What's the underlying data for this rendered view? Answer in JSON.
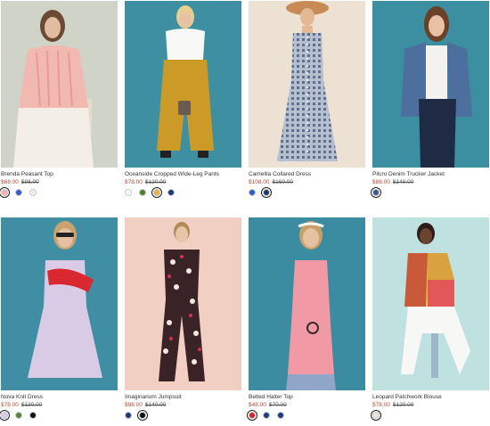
{
  "products": [
    {
      "name": "Brenda Peasant Top",
      "sale": "$68.00",
      "orig": "$98.00",
      "bg": "#cfd3c8",
      "swatches": [
        {
          "color": "#f3b1b5",
          "selected": true
        },
        {
          "color": "#2d5fc8"
        },
        {
          "color": "#f4efe6"
        }
      ]
    },
    {
      "name": "Oceanside Cropped Wide-Leg Pants",
      "sale": "$78.00",
      "orig": "$120.00",
      "bg": "#3e8fa2",
      "swatches": [
        {
          "color": "#ffffff"
        },
        {
          "color": "#4d7a35"
        },
        {
          "color": "#e7b43e",
          "selected": true
        },
        {
          "color": "#1d3a7a"
        }
      ]
    },
    {
      "name": "Camellia Collared Dress",
      "sale": "$108.00",
      "orig": "$160.00",
      "bg": "#ede1d3",
      "swatches": [
        {
          "color": "#2f5fc7"
        },
        {
          "color": "#203868",
          "selected": true
        }
      ]
    },
    {
      "name": "Pilcro Denim Trucker Jacket",
      "sale": "$88.00",
      "orig": "$140.00",
      "bg": "#3c8fa1",
      "swatches": [
        {
          "color": "#3a5990",
          "selected": true
        }
      ]
    },
    {
      "name": "Nova Knit Dress",
      "sale": "$78.00",
      "orig": "$130.00",
      "bg": "#3f8ea3",
      "swatches": [
        {
          "color": "#d9c9ec",
          "selected": true
        },
        {
          "color": "#4e8a3a"
        },
        {
          "color": "#111111"
        }
      ]
    },
    {
      "name": "Imaginarium Jumpsuit",
      "sale": "$98.00",
      "orig": "$140.00",
      "bg": "#f1cfc2",
      "swatches": [
        {
          "color": "#1e3a7a"
        },
        {
          "color": "#111111",
          "selected": true
        }
      ]
    },
    {
      "name": "Belted Halter Top",
      "sale": "$48.00",
      "orig": "$70.00",
      "bg": "#3b8ca0",
      "swatches": [
        {
          "color": "#d5232d",
          "selected": true
        },
        {
          "color": "#1e3d80"
        },
        {
          "color": "#1b3a8a"
        }
      ]
    },
    {
      "name": "Leopard Patchwork Blouse",
      "sale": "$78.00",
      "orig": "$120.00",
      "bg": "#bfe1df",
      "swatches": [
        {
          "color": "#efe5d8",
          "selected": true
        }
      ]
    }
  ]
}
